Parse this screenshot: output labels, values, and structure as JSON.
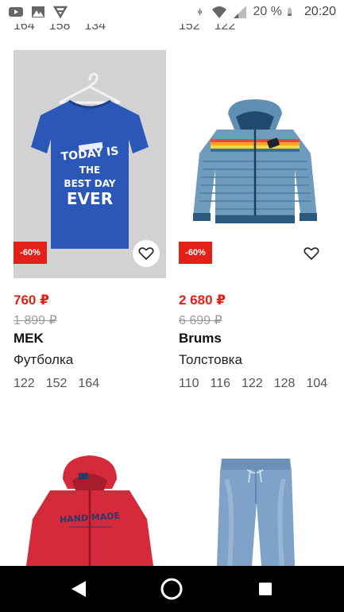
{
  "status_bar": {
    "battery_percent": "20 %",
    "time": "20:20",
    "left_icons": [
      "youtube-icon",
      "gallery-icon",
      "media-icon"
    ],
    "right_icons": [
      "vibrate-icon",
      "wifi-icon",
      "signal-icon",
      "battery-icon"
    ]
  },
  "top_row": {
    "left_sizes": [
      "164",
      "158",
      "134"
    ],
    "right_sizes": [
      "152",
      "122"
    ]
  },
  "products": [
    {
      "discount": "-60%",
      "price_new": "760 ₽",
      "price_old": "1 899 ₽",
      "brand": "MEK",
      "type": "Футболка",
      "sizes": [
        "122",
        "152",
        "164"
      ],
      "print_text": "TODAY IS THE BEST DAY EVER"
    },
    {
      "discount": "-60%",
      "price_new": "2 680 ₽",
      "price_old": "6 699 ₽",
      "brand": "Brums",
      "type": "Толстовка",
      "sizes": [
        "110",
        "116",
        "122",
        "128",
        "104"
      ]
    }
  ],
  "bottom_row": {
    "left_print_text": "HAND MADE"
  },
  "colors": {
    "accent_red": "#e32119",
    "old_price_grey": "#9a9a9a",
    "tshirt_blue": "#2a57b8",
    "hoodie_red": "#d42a3c",
    "jeans_blue": "#7fa3c8"
  },
  "nav_bar": {
    "buttons": [
      "back-icon",
      "home-icon",
      "recents-icon"
    ]
  }
}
